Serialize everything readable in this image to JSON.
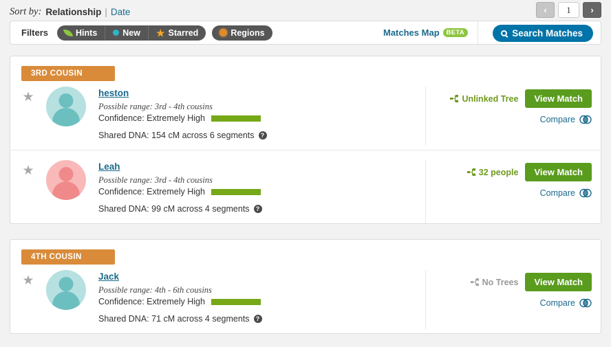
{
  "sort": {
    "label": "Sort by:",
    "active": "Relationship",
    "separator": "|",
    "alt": "Date"
  },
  "pager": {
    "prev_icon": "chevron-left-icon",
    "prev_glyph": "‹",
    "page": "1",
    "next_icon": "chevron-right-icon",
    "next_glyph": "›"
  },
  "filters": {
    "label": "Filters",
    "pills": [
      {
        "label": "Hints",
        "icon": "leaf-icon"
      },
      {
        "label": "New",
        "icon": "dot-icon"
      },
      {
        "label": "Starred",
        "icon": "star-icon",
        "glyph": "★"
      },
      {
        "label": "Regions",
        "icon": "region-dot-icon"
      }
    ],
    "matches_map": "Matches Map",
    "beta": "BETA",
    "search": "Search Matches",
    "search_icon": "search-icon"
  },
  "cards": [
    {
      "badge": "3RD COUSIN",
      "matches": [
        {
          "star_icon": "star-icon",
          "star_glyph": "★",
          "avatar": "avatar-teal",
          "name": "heston",
          "range": "Possible range: 3rd - 4th cousins",
          "confidence": "Confidence: Extremely High",
          "confidence_pct": 100,
          "shared_dna": "Shared DNA: 154 cM across 6 segments",
          "help_glyph": "?",
          "tree_label": "Unlinked Tree",
          "tree_state": "green",
          "tree_icon": "tree-icon",
          "view": "View Match",
          "compare": "Compare",
          "compare_icon": "venn-icon"
        },
        {
          "star_icon": "star-icon",
          "star_glyph": "★",
          "avatar": "avatar-pink",
          "name": "Leah ",
          "range": "Possible range: 3rd - 4th cousins",
          "confidence": "Confidence: Extremely High",
          "confidence_pct": 100,
          "shared_dna": "Shared DNA: 99 cM across 4 segments",
          "help_glyph": "?",
          "tree_label": "32 people",
          "tree_state": "green",
          "tree_icon": "tree-icon",
          "view": "View Match",
          "compare": "Compare",
          "compare_icon": "venn-icon"
        }
      ]
    },
    {
      "badge": "4TH COUSIN",
      "matches": [
        {
          "star_icon": "star-icon",
          "star_glyph": "★",
          "avatar": "avatar-teal",
          "name": "Jack ",
          "range": "Possible range: 4th - 6th cousins",
          "confidence": "Confidence: Extremely High",
          "confidence_pct": 100,
          "shared_dna": "Shared DNA: 71 cM across 4 segments",
          "help_glyph": "?",
          "tree_label": "No Trees",
          "tree_state": "gray",
          "tree_icon": "tree-icon",
          "view": "View Match",
          "compare": "Compare",
          "compare_icon": "venn-icon"
        }
      ]
    }
  ],
  "colors": {
    "badge_orange": "#d98b3a",
    "view_green": "#5a9c1e",
    "confidence_green": "#76a818",
    "link_blue": "#1b6a8c",
    "search_blue": "#0073a8",
    "beta_green": "#8dc63f",
    "pill_gray": "#565656"
  }
}
